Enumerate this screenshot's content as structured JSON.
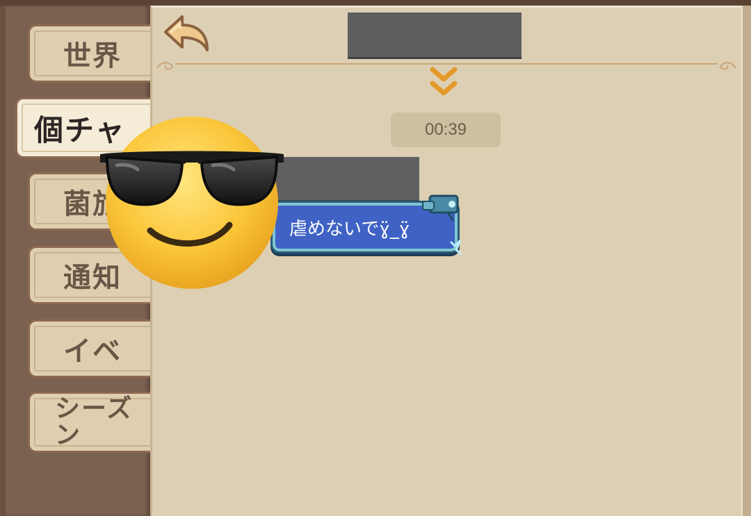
{
  "sidebar": {
    "tabs": [
      {
        "label": "世界"
      },
      {
        "label": "個チャ"
      },
      {
        "label": "菌旅"
      },
      {
        "label": "通知"
      },
      {
        "label": "イベ"
      },
      {
        "label": "シーズ\nン"
      }
    ],
    "active_index": 1
  },
  "header": {
    "title_redacted": true
  },
  "chat": {
    "timestamp": "00:39",
    "messages": [
      {
        "sender_redacted": true,
        "text": "虐めないでɣ̈̈_ɣ̈̈"
      }
    ]
  },
  "icons": {
    "back": "back-arrow-icon",
    "scroll_down": "double-chevron-down-icon",
    "sticker": "sunglasses-smiley-icon"
  },
  "colors": {
    "panel_bg": "#ddcfb3",
    "sidebar_bg": "#7b6150",
    "bubble_bg": "#3f62c4",
    "accent_orange": "#e49a2a"
  }
}
